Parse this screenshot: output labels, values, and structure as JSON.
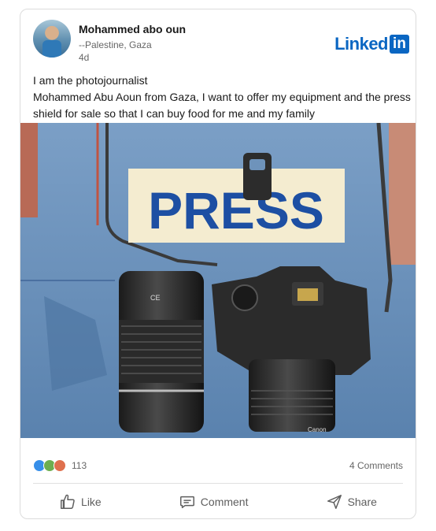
{
  "post": {
    "author_name": "Mohammed abo oun",
    "author_subtitle": "--Palestine, Gaza",
    "time_ago": "4d",
    "brand_word": "Linked",
    "brand_box": "in",
    "text_line_1": "I am the photojournalist",
    "text_line_2": "Mohammed Abu Aoun from Gaza, I want to offer my equipment and the press shield for sale so that I can buy food for me and my family",
    "image_text": {
      "press_label": "PRESS",
      "lens_marking": "CE",
      "camera_brand": "Canon"
    }
  },
  "social": {
    "reaction_icons": [
      "like-icon",
      "celebrate-icon",
      "love-icon"
    ],
    "reaction_count": "113",
    "comments_label": "4 Comments"
  },
  "actions": {
    "like_label": "Like",
    "comment_label": "Comment",
    "share_label": "Share"
  },
  "colors": {
    "brand": "#0a66c2",
    "vest": "#6e93bb",
    "text": "#191919",
    "muted": "#666666"
  }
}
